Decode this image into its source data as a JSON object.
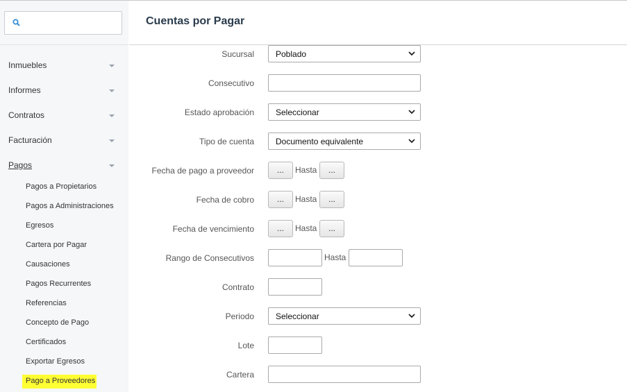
{
  "search": {
    "placeholder": ""
  },
  "sidebar": {
    "items": [
      {
        "label": "Inmuebles"
      },
      {
        "label": "Informes"
      },
      {
        "label": "Contratos"
      },
      {
        "label": "Facturación"
      },
      {
        "label": "Pagos"
      }
    ],
    "pagos_sub": [
      {
        "label": "Pagos a Propietarios"
      },
      {
        "label": "Pagos a Administraciones"
      },
      {
        "label": "Egresos"
      },
      {
        "label": "Cartera por Pagar"
      },
      {
        "label": "Causaciones"
      },
      {
        "label": "Pagos Recurrentes"
      },
      {
        "label": "Referencias"
      },
      {
        "label": "Concepto de Pago"
      },
      {
        "label": "Certificados"
      },
      {
        "label": "Exportar Egresos"
      },
      {
        "label": "Pago a Proveedores"
      }
    ]
  },
  "header": {
    "title": "Cuentas por Pagar"
  },
  "form": {
    "sucursal": {
      "label": "Sucursal",
      "value": "Poblado"
    },
    "consecutivo": {
      "label": "Consecutivo",
      "value": ""
    },
    "estado": {
      "label": "Estado aprobación",
      "value": "Seleccionar"
    },
    "tipo": {
      "label": "Tipo de cuenta",
      "value": "Documento equivalente"
    },
    "fecha_pago": {
      "label": "Fecha de pago a proveedor"
    },
    "fecha_cobro": {
      "label": "Fecha de cobro"
    },
    "fecha_venc": {
      "label": "Fecha de vencimiento"
    },
    "rango": {
      "label": "Rango de Consecutivos"
    },
    "contrato": {
      "label": "Contrato",
      "value": ""
    },
    "periodo": {
      "label": "Periodo",
      "value": "Seleccionar"
    },
    "lote": {
      "label": "Lote",
      "value": ""
    },
    "cartera": {
      "label": "Cartera",
      "value": ""
    },
    "date_button": "...",
    "hasta": "Hasta"
  }
}
